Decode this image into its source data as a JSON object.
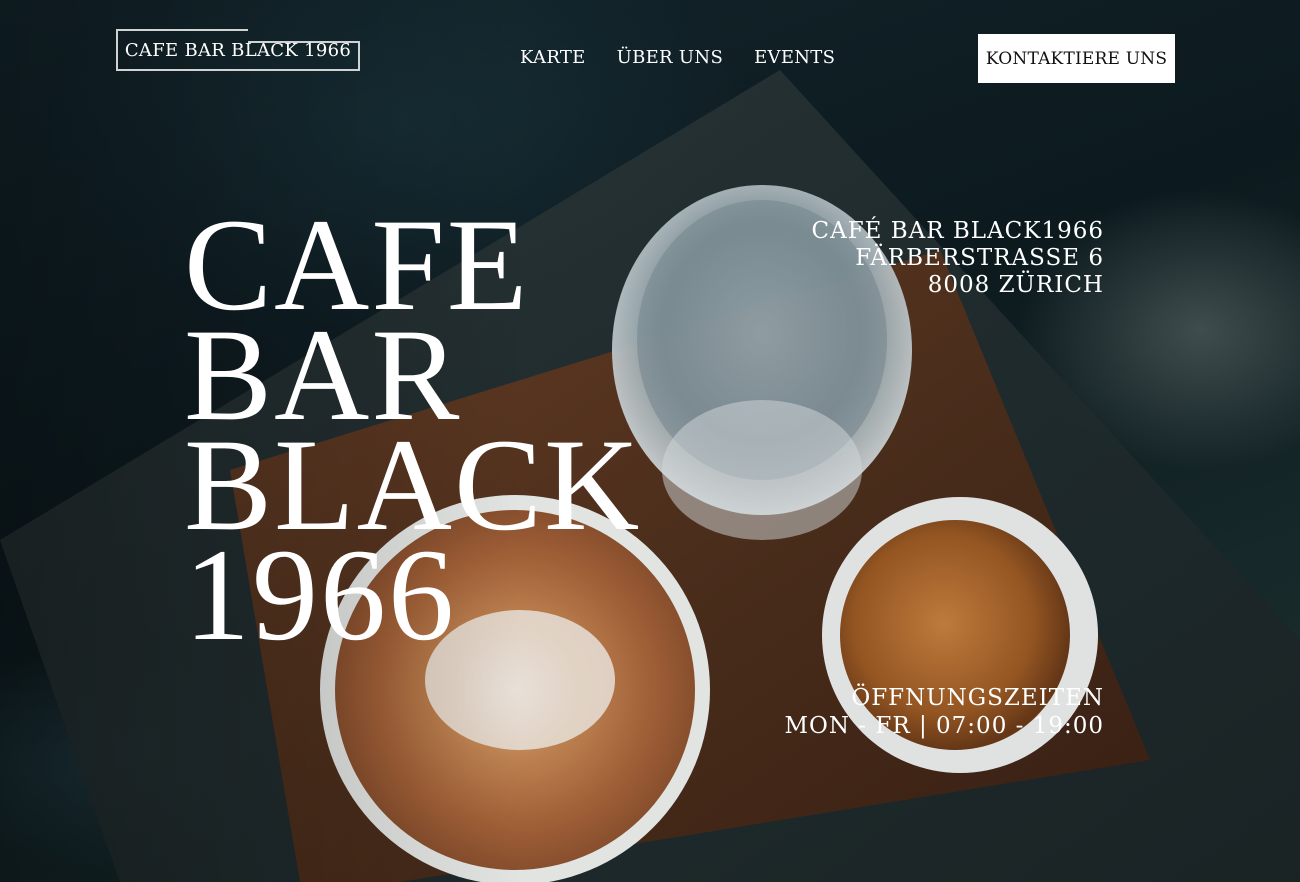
{
  "header": {
    "logo": "CAFE BAR BLACK 1966",
    "nav": [
      "KARTE",
      "ÜBER UNS",
      "EVENTS"
    ],
    "cta": "KONTAKTIERE UNS"
  },
  "hero": {
    "title_lines": [
      "CAFE",
      "BAR",
      "BLACK",
      "1966"
    ],
    "address_lines": [
      "CAFÉ BAR BLACK1966",
      "FÄRBERSTRASSE 6",
      "8008 ZÜRICH"
    ],
    "hours_title": "ÖFFNUNGSZEITEN",
    "hours_value": "MON - FR | 07:00 - 19:00"
  },
  "colors": {
    "text": "#ffffff",
    "cta_bg": "#ffffff",
    "cta_text": "#111111",
    "background": "#0f1c20",
    "wood": "#5b3722",
    "latte": "#b9753f"
  }
}
